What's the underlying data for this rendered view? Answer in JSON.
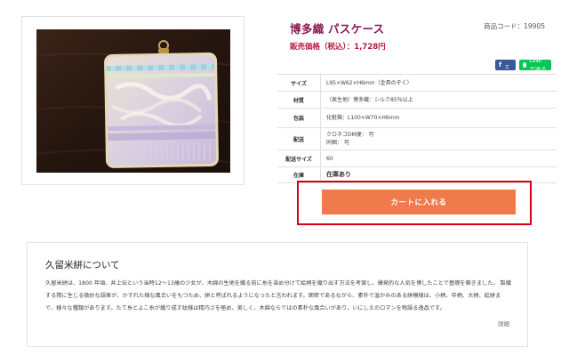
{
  "product": {
    "name": "博多織 パスケース",
    "code_label": "商品コード：19905",
    "price_label": "販売価格（税込）：",
    "price_value": "1,728円"
  },
  "share": {
    "facebook_label": "シェア",
    "line_label": "LINEで送る"
  },
  "specs": [
    {
      "key": "サイズ",
      "lines": [
        "L95×W62×H6mm（金具のぞく）"
      ]
    },
    {
      "key": "材質",
      "lines": [
        "（表生地）博多織：シルク85％以上"
      ]
    },
    {
      "key": "包装",
      "lines": [
        "化粧箱：L100×W70×H6mm"
      ]
    },
    {
      "key": "配送",
      "lines": [
        "クロネコDM便： 可",
        "同梱： 可"
      ]
    },
    {
      "key": "配送サイズ",
      "lines": [
        "60"
      ]
    },
    {
      "key": "在庫",
      "lines": [
        "在庫あり"
      ]
    }
  ],
  "cart": {
    "label": "カートに入れる"
  },
  "about": {
    "title": "久留米絣について",
    "text": "久留米絣は、1800 年頃、井上伝という当時12～13歳の少女が、木綿の生地を織る前に糸を染め分けて絵柄を織り出す方法を考案し、爆発的な人気を博したことで基礎を築きました。 製織する際に生じる微妙な誤差が、かすれた様な風合いをもつため、絣と呼ばれるようになったと言われます。囲密であるながら、素朴で温かみのある絣模様は、小柄、中柄、大柄、絵絣まで、様々な種類があります。たて糸とよこ糸が織り成す紋様は精巧さを極め、美しく、木綿ならではの素朴な風合いがあり、いにしえのロマンを物語る逸品です。",
    "more_label": "詳細"
  },
  "colors": {
    "title": "#8a1b52",
    "price": "#b51b3c",
    "cart_button": "#ef7b4d",
    "highlight": "#d0021b",
    "facebook": "#3b5998",
    "line": "#06c755"
  }
}
